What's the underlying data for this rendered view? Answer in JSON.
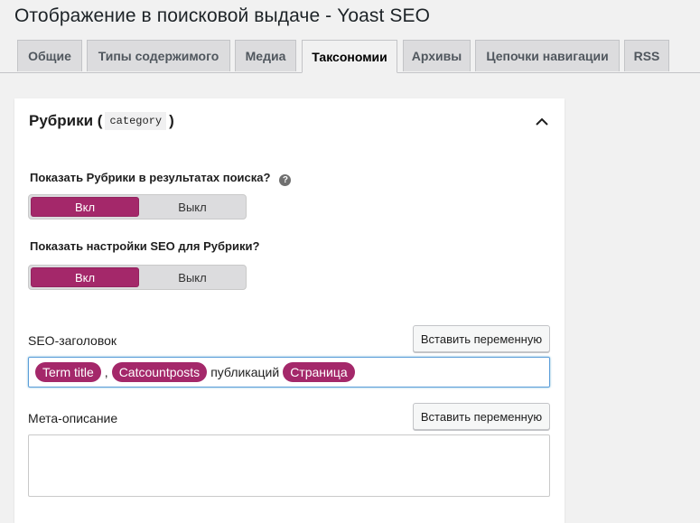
{
  "page": {
    "title": "Отображение в поисковой выдаче - Yoast SEO"
  },
  "tabs": [
    {
      "label": "Общие"
    },
    {
      "label": "Типы содержимого"
    },
    {
      "label": "Медиа"
    },
    {
      "label": "Таксономии",
      "active": true
    },
    {
      "label": "Архивы"
    },
    {
      "label": "Цепочки навигации"
    },
    {
      "label": "RSS"
    }
  ],
  "card": {
    "title_prefix": "Рубрики (",
    "code": "category",
    "title_suffix": ")",
    "collapse_icon": "chevron-up-icon",
    "show_in_search": {
      "label": "Показать Рубрики в результатах поиска?",
      "help_icon": "?",
      "on": "Вкл",
      "off": "Выкл",
      "value": "on"
    },
    "show_seo_settings": {
      "label": "Показать настройки SEO для Рубрики?",
      "on": "Вкл",
      "off": "Выкл",
      "value": "on"
    },
    "seo_title": {
      "label": "SEO-заголовок",
      "insert_button": "Вставить переменную",
      "tokens": [
        "Term title",
        ",",
        "Catcountposts",
        "публикаций",
        "Страница"
      ]
    },
    "meta_description": {
      "label": "Мета-описание",
      "insert_button": "Вставить переменную",
      "value": ""
    }
  },
  "colors": {
    "accent": "#a4286a",
    "background": "#f1f1f1",
    "card": "#ffffff",
    "focus_border": "#5b9dd9"
  }
}
